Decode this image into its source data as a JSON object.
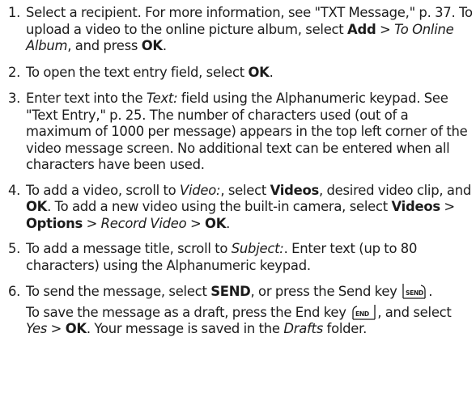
{
  "steps": [
    {
      "number": "1.",
      "segments": [
        {
          "t": "Select a recipient. For more information, see \"TXT Message,\" p. 37. To upload a video to the online picture album, select "
        },
        {
          "t": "Add",
          "b": true
        },
        {
          "t": " > "
        },
        {
          "t": "To Online Album",
          "i": true
        },
        {
          "t": ", and press "
        },
        {
          "t": "OK",
          "b": true
        },
        {
          "t": "."
        }
      ]
    },
    {
      "number": "2.",
      "segments": [
        {
          "t": "To open the text entry field, select "
        },
        {
          "t": "OK",
          "b": true
        },
        {
          "t": "."
        }
      ]
    },
    {
      "number": "3.",
      "segments": [
        {
          "t": "Enter text into the "
        },
        {
          "t": "Text:",
          "i": true
        },
        {
          "t": " field using the Alphanumeric keypad. See \"Text Entry,\" p. 25. The number of characters used (out of a maximum of 1000 per message) appears in the top left corner of the video message screen. No additional text can be entered when all characters have been used."
        }
      ]
    },
    {
      "number": "4.",
      "segments": [
        {
          "t": "To add a video, scroll to "
        },
        {
          "t": "Video:",
          "i": true
        },
        {
          "t": ", select "
        },
        {
          "t": "Videos",
          "b": true
        },
        {
          "t": ", desired video clip, and "
        },
        {
          "t": "OK",
          "b": true
        },
        {
          "t": ". To add a new video using the built-in camera, select "
        },
        {
          "t": "Videos",
          "b": true
        },
        {
          "t": " > "
        },
        {
          "t": "Options",
          "b": true
        },
        {
          "t": " > "
        },
        {
          "t": "Record Video",
          "i": true
        },
        {
          "t": " > "
        },
        {
          "t": "OK",
          "b": true
        },
        {
          "t": "."
        }
      ]
    },
    {
      "number": "5.",
      "segments": [
        {
          "t": "To add a message title, scroll to "
        },
        {
          "t": "Subject:",
          "i": true
        },
        {
          "t": ". Enter text (up to 80 characters) using the Alphanumeric keypad."
        }
      ]
    },
    {
      "number": "6.",
      "segments": [
        {
          "t": "To send the message, select "
        },
        {
          "t": "SEND",
          "b": true
        },
        {
          "t": ", or press the Send key "
        },
        {
          "key": "send-key-icon"
        },
        {
          "t": "."
        }
      ],
      "extra_segments": [
        {
          "t": "To save the message as a draft, press the End key "
        },
        {
          "key": "end-key-icon"
        },
        {
          "t": ", and select "
        },
        {
          "t": "Yes",
          "i": true
        },
        {
          "t": " > "
        },
        {
          "t": "OK",
          "b": true
        },
        {
          "t": ". Your message is saved in the "
        },
        {
          "t": "Drafts",
          "i": true
        },
        {
          "t": " folder."
        }
      ]
    }
  ],
  "key_icons": {
    "send-key-icon": {
      "label": "SEND"
    },
    "end-key-icon": {
      "label": "END"
    }
  }
}
